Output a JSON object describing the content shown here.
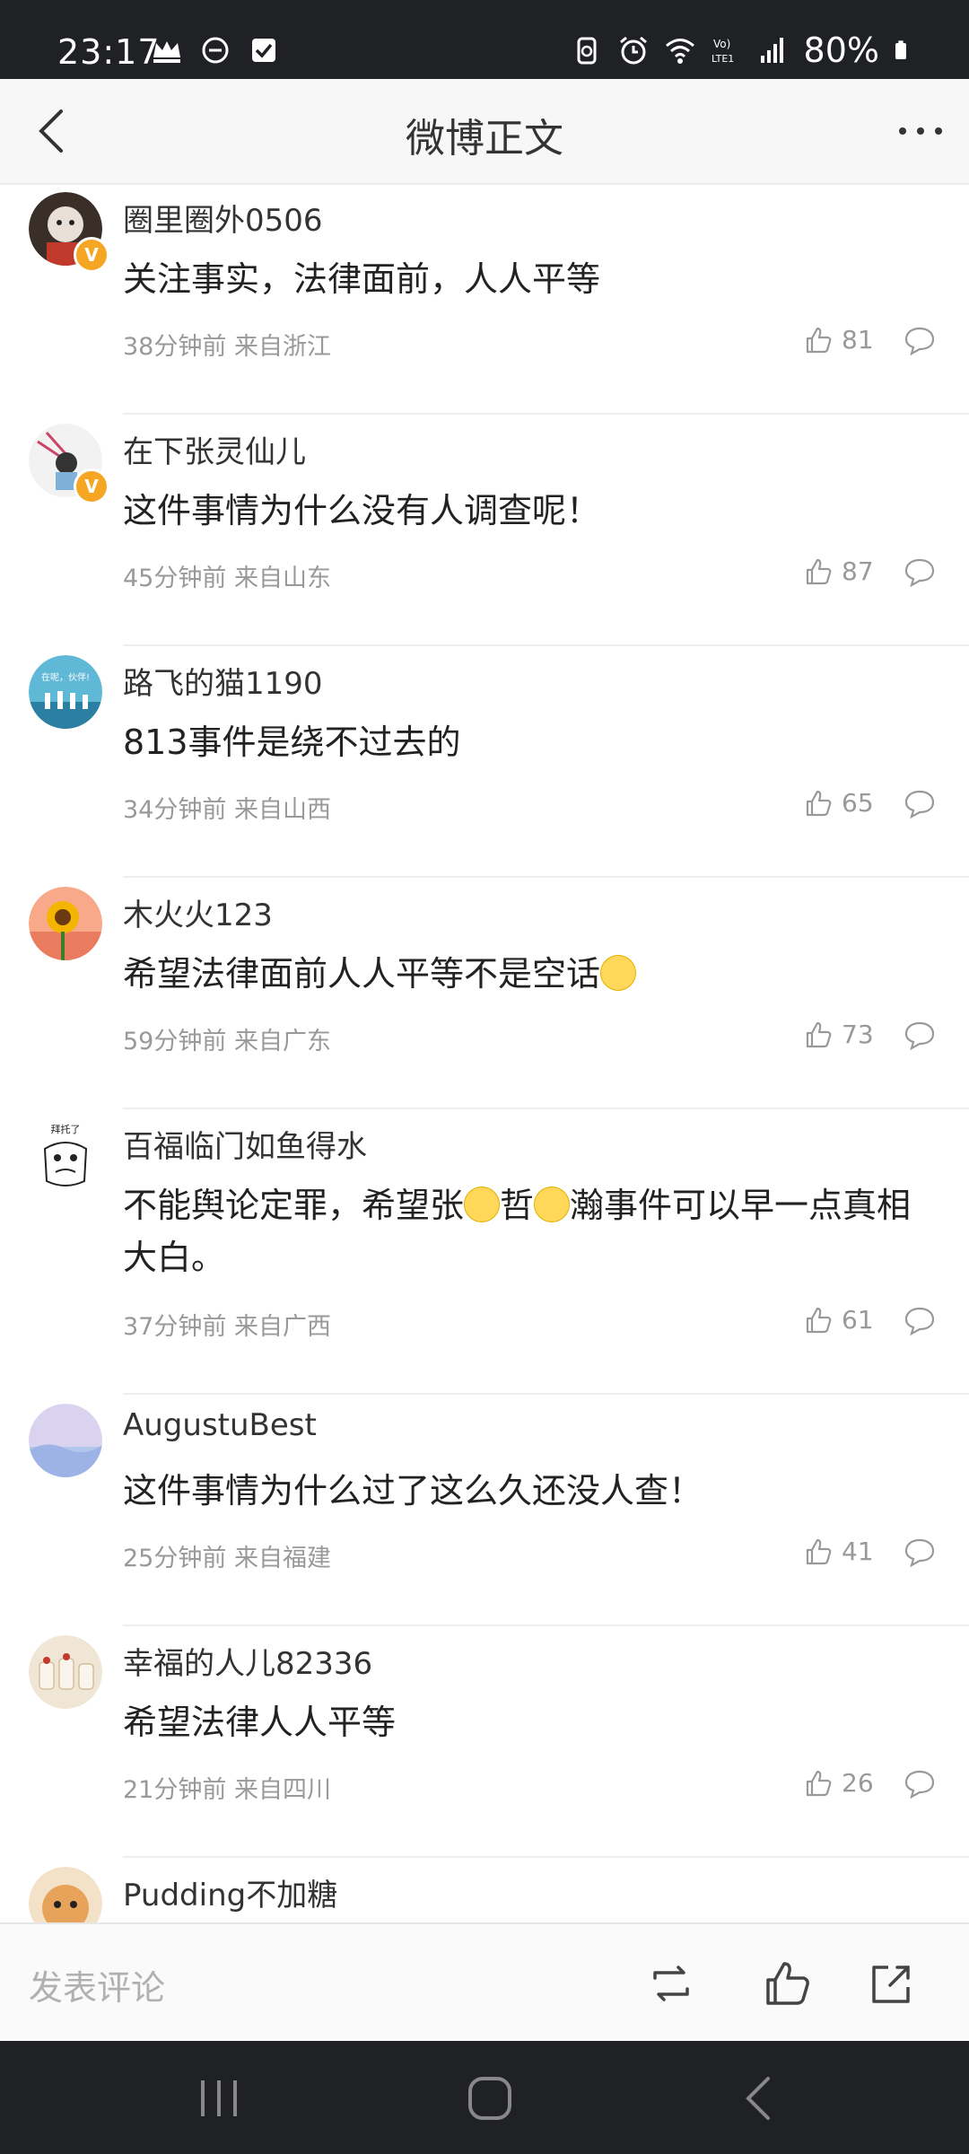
{
  "status_bar": {
    "time": "23:17",
    "battery": "80%",
    "icons": [
      "crown-icon",
      "minus-circle-icon",
      "checkbox-icon",
      "recycle-icon",
      "alarm-icon",
      "wifi-icon",
      "volte-icon",
      "signal-icon",
      "battery-icon"
    ]
  },
  "header": {
    "title": "微博正文"
  },
  "comments": [
    {
      "user": "圈里圈外0506",
      "text": "关注事实，法律面前，人人平等",
      "time": "38分钟前 来自浙江",
      "likes": "81",
      "verified": true
    },
    {
      "user": "在下张灵仙儿",
      "text": "这件事情为什么没有人调查呢！",
      "time": "45分钟前 来自山东",
      "likes": "87",
      "verified": true
    },
    {
      "user": "路飞的猫1190",
      "text": "813事件是绕不过去的",
      "time": "34分钟前 来自山西",
      "likes": "65",
      "avatar_text": "在呢，伙伴!"
    },
    {
      "user": "木火火123",
      "text_before": "希望法律面前人人平等不是空话",
      "time": "59分钟前 来自广东",
      "likes": "73"
    },
    {
      "user": "百福临门如鱼得水",
      "text_a": "不能舆论定罪，希望张",
      "text_b": "哲",
      "text_c": "瀚事件可以早一点真相大白。",
      "time": "37分钟前 来自广西",
      "likes": "61",
      "avatar_text": "拜托了"
    },
    {
      "user": "AugustuBest",
      "text": "这件事情为什么过了这么久还没人查！",
      "time": "25分钟前 来自福建",
      "likes": "41"
    },
    {
      "user": "幸福的人儿82336",
      "text": "希望法律人人平等",
      "time": "21分钟前 来自四川",
      "likes": "26"
    },
    {
      "user": "Pudding不加糖"
    }
  ],
  "bottom_bar": {
    "compose_placeholder": "发表评论"
  },
  "colors": {
    "status_bg": "#1f2125",
    "title_bg": "#f7f7f7",
    "meta_text": "#999999",
    "verified_badge": "#f5a623"
  }
}
